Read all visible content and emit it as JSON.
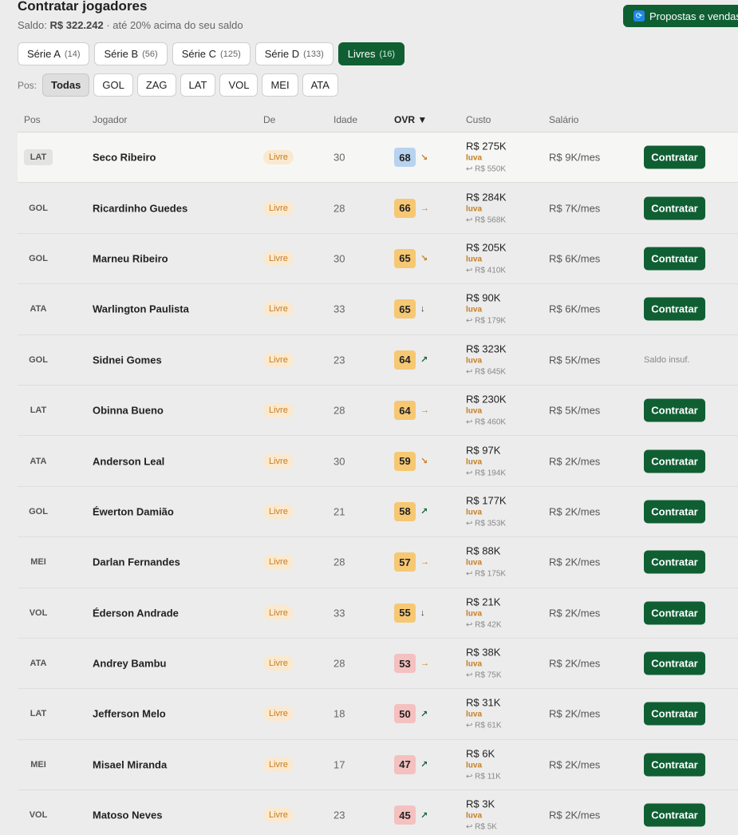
{
  "header": {
    "title": "Contratar jogadores",
    "saldo_label": "Saldo:",
    "saldo_value": "R$ 322.242",
    "saldo_note": "· até 20% acima do seu saldo",
    "proposals_button": "Propostas e vendas",
    "proposals_icon": "refresh-icon"
  },
  "series": [
    {
      "label": "Série A",
      "count": "(14)",
      "active": false
    },
    {
      "label": "Série B",
      "count": "(56)",
      "active": false
    },
    {
      "label": "Série C",
      "count": "(125)",
      "active": false
    },
    {
      "label": "Série D",
      "count": "(133)",
      "active": false
    },
    {
      "label": "Livres",
      "count": "(16)",
      "active": true
    }
  ],
  "position_filter": {
    "label": "Pos:",
    "options": [
      {
        "label": "Todas",
        "active": true
      },
      {
        "label": "GOL",
        "active": false
      },
      {
        "label": "ZAG",
        "active": false
      },
      {
        "label": "LAT",
        "active": false
      },
      {
        "label": "VOL",
        "active": false
      },
      {
        "label": "MEI",
        "active": false
      },
      {
        "label": "ATA",
        "active": false
      }
    ]
  },
  "columns": {
    "pos": "Pos",
    "player": "Jogador",
    "from": "De",
    "age": "Idade",
    "ovr": "OVR ▼",
    "cost": "Custo",
    "salary": "Salário"
  },
  "colors": {
    "accent": "#0f5f33",
    "ovr_blue": "#b7d3f0",
    "ovr_orange": "#f6c873",
    "ovr_red": "#f5c0c0",
    "trend_down": "#c67d22",
    "trend_up": "#0f5f33"
  },
  "rows": [
    {
      "pos": "LAT",
      "name": "Seco Ribeiro",
      "from": "Livre",
      "age": "30",
      "ovr": "68",
      "ovr_color": "blue",
      "trend": "↘",
      "trend_dir": "down",
      "cost": "R$ 275K",
      "luva": "luva",
      "return": "↩ R$ 550K",
      "salary": "R$ 9K/mes",
      "action": "Contratar"
    },
    {
      "pos": "GOL",
      "name": "Ricardinho Guedes",
      "from": "Livre",
      "age": "28",
      "ovr": "66",
      "ovr_color": "orange",
      "trend": "→",
      "trend_dir": "down",
      "cost": "R$ 284K",
      "luva": "luva",
      "return": "↩ R$ 568K",
      "salary": "R$ 7K/mes",
      "action": "Contratar"
    },
    {
      "pos": "GOL",
      "name": "Marneu Ribeiro",
      "from": "Livre",
      "age": "30",
      "ovr": "65",
      "ovr_color": "orange",
      "trend": "↘",
      "trend_dir": "down",
      "cost": "R$ 205K",
      "luva": "luva",
      "return": "↩ R$ 410K",
      "salary": "R$ 6K/mes",
      "action": "Contratar"
    },
    {
      "pos": "ATA",
      "name": "Warlington Paulista",
      "from": "Livre",
      "age": "33",
      "ovr": "65",
      "ovr_color": "orange",
      "trend": "↓",
      "trend_dir": "dark",
      "cost": "R$ 90K",
      "luva": "luva",
      "return": "↩ R$ 179K",
      "salary": "R$ 6K/mes",
      "action": "Contratar"
    },
    {
      "pos": "GOL",
      "name": "Sidnei Gomes",
      "from": "Livre",
      "age": "23",
      "ovr": "64",
      "ovr_color": "orange",
      "trend": "↗",
      "trend_dir": "up",
      "cost": "R$ 323K",
      "luva": "luva",
      "return": "↩ R$ 645K",
      "salary": "R$ 5K/mes",
      "action": "Saldo insuf."
    },
    {
      "pos": "LAT",
      "name": "Obinna Bueno",
      "from": "Livre",
      "age": "28",
      "ovr": "64",
      "ovr_color": "orange",
      "trend": "→",
      "trend_dir": "down",
      "cost": "R$ 230K",
      "luva": "luva",
      "return": "↩ R$ 460K",
      "salary": "R$ 5K/mes",
      "action": "Contratar"
    },
    {
      "pos": "ATA",
      "name": "Anderson Leal",
      "from": "Livre",
      "age": "30",
      "ovr": "59",
      "ovr_color": "orange",
      "trend": "↘",
      "trend_dir": "down",
      "cost": "R$ 97K",
      "luva": "luva",
      "return": "↩ R$ 194K",
      "salary": "R$ 2K/mes",
      "action": "Contratar"
    },
    {
      "pos": "GOL",
      "name": "Éwerton Damião",
      "from": "Livre",
      "age": "21",
      "ovr": "58",
      "ovr_color": "orange",
      "trend": "↗",
      "trend_dir": "up",
      "cost": "R$ 177K",
      "luva": "luva",
      "return": "↩ R$ 353K",
      "salary": "R$ 2K/mes",
      "action": "Contratar"
    },
    {
      "pos": "MEI",
      "name": "Darlan Fernandes",
      "from": "Livre",
      "age": "28",
      "ovr": "57",
      "ovr_color": "orange",
      "trend": "→",
      "trend_dir": "down",
      "cost": "R$ 88K",
      "luva": "luva",
      "return": "↩ R$ 175K",
      "salary": "R$ 2K/mes",
      "action": "Contratar"
    },
    {
      "pos": "VOL",
      "name": "Éderson Andrade",
      "from": "Livre",
      "age": "33",
      "ovr": "55",
      "ovr_color": "orange",
      "trend": "↓",
      "trend_dir": "dark",
      "cost": "R$ 21K",
      "luva": "luva",
      "return": "↩ R$ 42K",
      "salary": "R$ 2K/mes",
      "action": "Contratar"
    },
    {
      "pos": "ATA",
      "name": "Andrey Bambu",
      "from": "Livre",
      "age": "28",
      "ovr": "53",
      "ovr_color": "red",
      "trend": "→",
      "trend_dir": "down",
      "cost": "R$ 38K",
      "luva": "luva",
      "return": "↩ R$ 75K",
      "salary": "R$ 2K/mes",
      "action": "Contratar"
    },
    {
      "pos": "LAT",
      "name": "Jefferson Melo",
      "from": "Livre",
      "age": "18",
      "ovr": "50",
      "ovr_color": "red",
      "trend": "↗",
      "trend_dir": "up",
      "cost": "R$ 31K",
      "luva": "luva",
      "return": "↩ R$ 61K",
      "salary": "R$ 2K/mes",
      "action": "Contratar"
    },
    {
      "pos": "MEI",
      "name": "Misael Miranda",
      "from": "Livre",
      "age": "17",
      "ovr": "47",
      "ovr_color": "red",
      "trend": "↗",
      "trend_dir": "up",
      "cost": "R$ 6K",
      "luva": "luva",
      "return": "↩ R$ 11K",
      "salary": "R$ 2K/mes",
      "action": "Contratar"
    },
    {
      "pos": "VOL",
      "name": "Matoso Neves",
      "from": "Livre",
      "age": "23",
      "ovr": "45",
      "ovr_color": "red",
      "trend": "↗",
      "trend_dir": "up",
      "cost": "R$ 3K",
      "luva": "luva",
      "return": "↩ R$ 5K",
      "salary": "R$ 2K/mes",
      "action": "Contratar"
    }
  ]
}
